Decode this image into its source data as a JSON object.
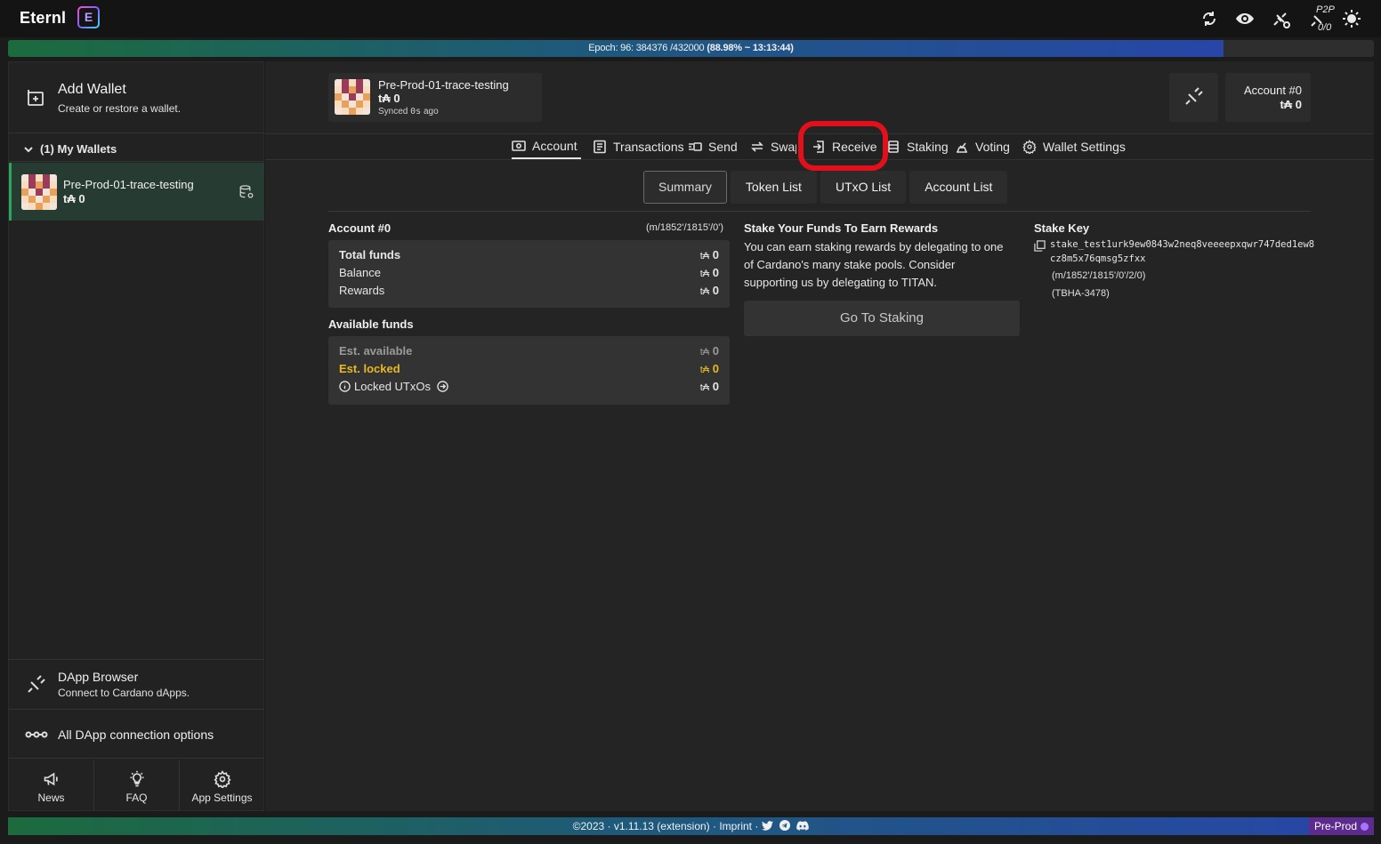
{
  "app": {
    "name": "Eternl",
    "logo_glyph": "E"
  },
  "topbar": {
    "p2p_label": "P2P",
    "p2p_count": "0/0"
  },
  "epoch": {
    "prefix": "Epoch: 96: 384376 /432000",
    "progress": "(88.98% ~ 13:13:44)",
    "progress_fraction": 0.8898
  },
  "sidebar": {
    "add_wallet_title": "Add Wallet",
    "add_wallet_sub": "Create or restore a wallet.",
    "my_wallets": "(1) My Wallets",
    "wallet": {
      "name": "Pre-Prod-01-trace-testing",
      "balance": "t₳ 0"
    },
    "dapp_title": "DApp Browser",
    "dapp_sub": "Connect to Cardano dApps.",
    "dapp_options": "All DApp connection options",
    "bottom_nav": [
      {
        "label": "News",
        "icon": "megaphone-icon"
      },
      {
        "label": "FAQ",
        "icon": "lightbulb-icon"
      },
      {
        "label": "App Settings",
        "icon": "gear-icon"
      }
    ]
  },
  "wallet_card": {
    "name": "Pre-Prod-01-trace-testing",
    "balance": "t₳ 0",
    "sync_prefix": "Synced",
    "sync_age": "0s",
    "sync_suffix": "ago"
  },
  "account_card": {
    "name": "Account #0",
    "balance": "t₳ 0"
  },
  "tabs": [
    {
      "label": "Account",
      "icon": "account-icon",
      "active": true
    },
    {
      "label": "Transactions",
      "icon": "list-icon"
    },
    {
      "label": "Send",
      "icon": "send-icon"
    },
    {
      "label": "Swap",
      "icon": "swap-icon"
    },
    {
      "label": "Receive",
      "icon": "receive-icon",
      "highlighted": true
    },
    {
      "label": "Staking",
      "icon": "staking-icon"
    },
    {
      "label": "Voting",
      "icon": "voting-icon"
    },
    {
      "label": "Wallet Settings",
      "icon": "gear-icon"
    }
  ],
  "subtabs": [
    "Summary",
    "Token List",
    "UTxO List",
    "Account List"
  ],
  "summary": {
    "account_title": "Account #0",
    "account_path": "(m/1852'/1815'/0')",
    "total_funds": {
      "label": "Total funds",
      "value": "0"
    },
    "balance": {
      "label": "Balance",
      "value": "0"
    },
    "rewards": {
      "label": "Rewards",
      "value": "0"
    },
    "available_title": "Available funds",
    "est_available": {
      "label": "Est. available",
      "value": "0"
    },
    "est_locked": {
      "label": "Est. locked",
      "value": "0"
    },
    "locked_utxos": {
      "label": "Locked UTxOs",
      "value": "0"
    },
    "currency_unit": "t₳"
  },
  "staking": {
    "title": "Stake Your Funds To Earn Rewards",
    "text": "You can earn staking rewards by delegating to one of Cardano's many stake pools. Consider supporting us by delegating to TITAN.",
    "button": "Go To Staking"
  },
  "stake_key": {
    "title": "Stake Key",
    "value": "stake_test1urk9ew0843w2neq8veeeepxqwr747ded1ew8cz8m5x76qmsg5zfxx",
    "path": "(m/1852'/1815'/0'/2/0)",
    "tag": "(TBHA-3478)"
  },
  "footer": {
    "text": "©2023 · v1.11.13 (extension) · Imprint ·",
    "network": "Pre-Prod"
  },
  "colors": {
    "accent_green": "#2ba55d",
    "warning_yellow": "#e8b923",
    "highlight_red": "#e2101b",
    "network_purple": "#5d2b8e"
  }
}
